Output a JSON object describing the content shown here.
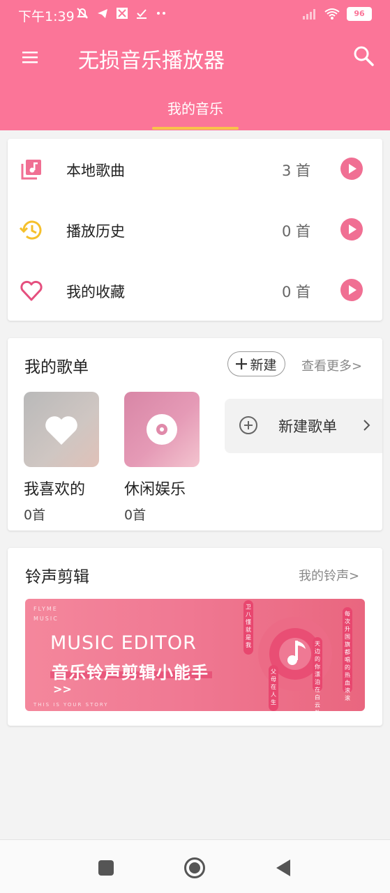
{
  "status_bar": {
    "time": "下午1:39",
    "battery": "96"
  },
  "header": {
    "title": "无损音乐播放器",
    "active_tab": "我的音乐"
  },
  "quick_access": [
    {
      "label": "本地歌曲",
      "count": "3 首",
      "icon": "music-library-icon"
    },
    {
      "label": "播放历史",
      "count": "0 首",
      "icon": "history-icon"
    },
    {
      "label": "我的收藏",
      "count": "0 首",
      "icon": "heart-icon"
    }
  ],
  "playlists_section": {
    "title": "我的歌单",
    "new_button": "新建",
    "more_link": "查看更多>",
    "items": [
      {
        "name": "我喜欢的",
        "count": "0首",
        "icon": "heart-icon"
      },
      {
        "name": "休闲娱乐",
        "count": "0首",
        "icon": "disc-icon"
      }
    ],
    "new_playlist_label": "新建歌单"
  },
  "ringtone_section": {
    "title": "铃声剪辑",
    "more_link": "我的铃声>",
    "banner": {
      "brand_small": "FLYME",
      "brand_small2": "MUSIC",
      "title_en": "MUSIC EDITOR",
      "title_cn": "音乐铃声剪辑小能手",
      "arrow": ">>",
      "tagline": "THIS IS YOUR STORY",
      "tags": [
        "卫八懂",
        "就是我",
        "天边的你",
        "漂泊在白云外",
        "父母在",
        "人生",
        "每次升国旗都唱的热血滚滚"
      ]
    }
  },
  "colors": {
    "primary": "#fb7598",
    "accent": "#f9c24a",
    "play": "#f06f93"
  }
}
